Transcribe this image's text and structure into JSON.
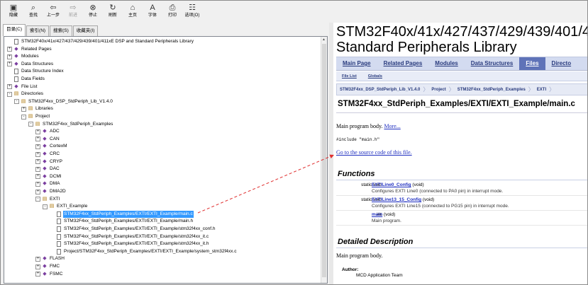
{
  "toolbar": {
    "buttons": [
      {
        "label": "隐藏",
        "icon": "hide-icon",
        "disabled": false
      },
      {
        "label": "查找",
        "icon": "find-icon",
        "disabled": false
      },
      {
        "label": "上一步",
        "icon": "back-arrow-icon",
        "disabled": false
      },
      {
        "label": "前进",
        "icon": "forward-arrow-icon",
        "disabled": true
      },
      {
        "label": "停止",
        "icon": "stop-icon",
        "disabled": false
      },
      {
        "label": "刷新",
        "icon": "refresh-icon",
        "disabled": false
      },
      {
        "label": "主页",
        "icon": "home-icon",
        "disabled": false
      },
      {
        "label": "字体",
        "icon": "font-icon",
        "disabled": false
      },
      {
        "label": "打印",
        "icon": "print-icon",
        "disabled": false
      },
      {
        "label": "选项(O)",
        "icon": "options-icon",
        "disabled": false
      }
    ]
  },
  "tabs": [
    {
      "label": "目录(C)",
      "active": true
    },
    {
      "label": "索引(N)",
      "active": false
    },
    {
      "label": "搜索(S)",
      "active": false
    },
    {
      "label": "收藏夹(I)",
      "active": false
    }
  ],
  "tree": [
    {
      "level": 0,
      "exp": "",
      "icon": "page",
      "label": "STM32F40x/41x/427/437/429/439/401/411xE DSP and Standard Peripherals Library"
    },
    {
      "level": 0,
      "exp": "+",
      "icon": "book",
      "label": "Related Pages"
    },
    {
      "level": 0,
      "exp": "+",
      "icon": "book",
      "label": "Modules"
    },
    {
      "level": 0,
      "exp": "+",
      "icon": "book",
      "label": "Data Structures"
    },
    {
      "level": 0,
      "exp": "",
      "icon": "page",
      "label": "Data Structure Index"
    },
    {
      "level": 0,
      "exp": "",
      "icon": "page",
      "label": "Data Fields"
    },
    {
      "level": 0,
      "exp": "+",
      "icon": "book",
      "label": "File List"
    },
    {
      "level": 0,
      "exp": "-",
      "icon": "folder",
      "label": "Directories"
    },
    {
      "level": 1,
      "exp": "-",
      "icon": "folder",
      "label": "STM32F4xx_DSP_StdPeriph_Lib_V1.4.0"
    },
    {
      "level": 2,
      "exp": "+",
      "icon": "folder",
      "label": "Libraries"
    },
    {
      "level": 2,
      "exp": "-",
      "icon": "folder",
      "label": "Project"
    },
    {
      "level": 3,
      "exp": "-",
      "icon": "folder",
      "label": "STM32F4xx_StdPeriph_Examples"
    },
    {
      "level": 4,
      "exp": "+",
      "icon": "book",
      "label": "ADC"
    },
    {
      "level": 4,
      "exp": "+",
      "icon": "book",
      "label": "CAN"
    },
    {
      "level": 4,
      "exp": "+",
      "icon": "book",
      "label": "CortexM"
    },
    {
      "level": 4,
      "exp": "+",
      "icon": "book",
      "label": "CRC"
    },
    {
      "level": 4,
      "exp": "+",
      "icon": "book",
      "label": "CRYP"
    },
    {
      "level": 4,
      "exp": "+",
      "icon": "book",
      "label": "DAC"
    },
    {
      "level": 4,
      "exp": "+",
      "icon": "book",
      "label": "DCMI"
    },
    {
      "level": 4,
      "exp": "+",
      "icon": "book",
      "label": "DMA"
    },
    {
      "level": 4,
      "exp": "+",
      "icon": "book",
      "label": "DMA2D"
    },
    {
      "level": 4,
      "exp": "-",
      "icon": "folder",
      "label": "EXTI"
    },
    {
      "level": 5,
      "exp": "-",
      "icon": "folder",
      "label": "EXTI_Example"
    },
    {
      "level": 6,
      "exp": "",
      "icon": "page",
      "label": "STM32F4xx_StdPeriph_Examples/EXTI/EXTI_Example/main.c",
      "selected": true
    },
    {
      "level": 6,
      "exp": "",
      "icon": "page",
      "label": "STM32F4xx_StdPeriph_Examples/EXTI/EXTI_Example/main.h"
    },
    {
      "level": 6,
      "exp": "",
      "icon": "page",
      "label": "STM32F4xx_StdPeriph_Examples/EXTI/EXTI_Example/stm32f4xx_conf.h"
    },
    {
      "level": 6,
      "exp": "",
      "icon": "page",
      "label": "STM32F4xx_StdPeriph_Examples/EXTI/EXTI_Example/stm32f4xx_it.c"
    },
    {
      "level": 6,
      "exp": "",
      "icon": "page",
      "label": "STM32F4xx_StdPeriph_Examples/EXTI/EXTI_Example/stm32f4xx_it.h"
    },
    {
      "level": 6,
      "exp": "",
      "icon": "page",
      "label": "Project/STM32F4xx_StdPeriph_Examples/EXTI/EXTI_Example/system_stm32f4xx.c"
    },
    {
      "level": 4,
      "exp": "+",
      "icon": "book",
      "label": "FLASH"
    },
    {
      "level": 4,
      "exp": "+",
      "icon": "book",
      "label": "FMC"
    },
    {
      "level": 4,
      "exp": "+",
      "icon": "book",
      "label": "FSMC"
    }
  ],
  "doc": {
    "title_line1": "STM32F40x/41x/427/437/429/439/401/4",
    "title_line2": "Standard Peripherals Library",
    "nav_tabs": [
      {
        "label": "Main Page",
        "active": false
      },
      {
        "label": "Related Pages",
        "active": false
      },
      {
        "label": "Modules",
        "active": false
      },
      {
        "label": "Data Structures",
        "active": false
      },
      {
        "label": "Files",
        "active": true
      },
      {
        "label": "Directo",
        "active": false
      }
    ],
    "sub_tabs": [
      "File List",
      "Globals"
    ],
    "path": [
      "STM32F4xx_DSP_StdPeriph_Lib_V1.4.0",
      "Project",
      "STM32F4xx_StdPeriph_Examples",
      "EXTI"
    ],
    "heading": "STM32F4xx_StdPeriph_Examples/EXTI/EXTI_Example/main.c",
    "brief": "Main program body.",
    "more": "More...",
    "include": "#include \"main.h\"",
    "source_link": "Go to the source code of this file.",
    "functions_title": "Functions",
    "functions": [
      {
        "type": "static void",
        "name": "EXTILine0_Config",
        "args": " (void)",
        "desc": "Configures EXTI Line0 (connected to PA0 pin) in interrupt mode."
      },
      {
        "type": "static void",
        "name": "EXTILine13_15_Config",
        "args": " (void)",
        "desc": "Configures EXTI Line15 (connected to PG15 pin) in interrupt mode."
      },
      {
        "type": "int",
        "name": "main",
        "args": " (void)",
        "desc": "Main program."
      }
    ],
    "detailed_title": "Detailed Description",
    "detailed_text": "Main program body.",
    "author_label": "Author:",
    "author_value": "MCD Application Team"
  },
  "colors": {
    "selection": "#3399ff",
    "active_tab": "#5f73b8",
    "link": "#2030c0",
    "arrow": "#e03030"
  }
}
